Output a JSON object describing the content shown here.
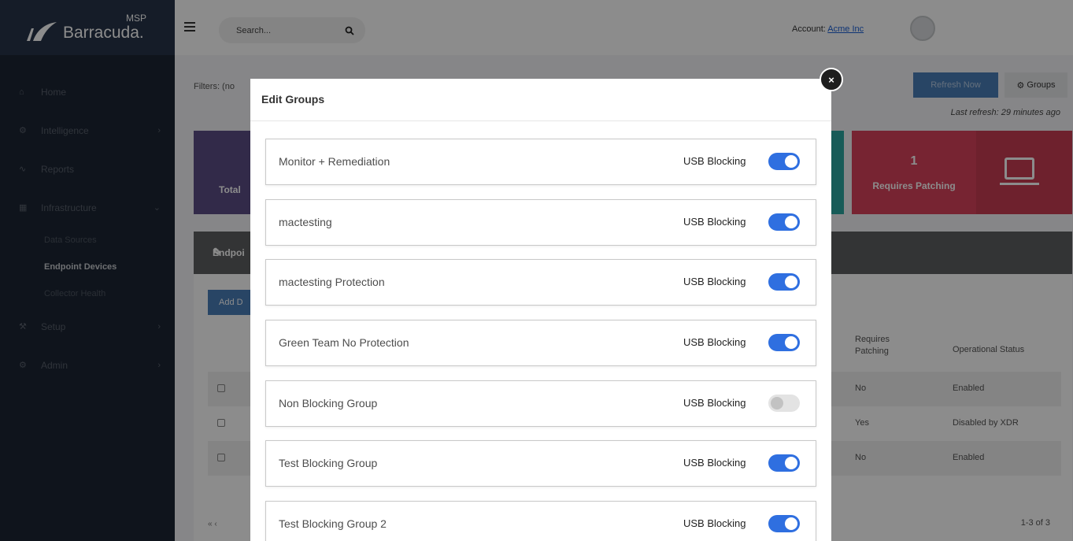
{
  "logo": {
    "msp": "MSP",
    "brand": "Barracuda."
  },
  "topbar": {
    "search_placeholder": "Search...",
    "search_icon": "search-icon",
    "account_label": "Account:",
    "account_name": "Acme Inc"
  },
  "sidebar": {
    "items": [
      {
        "label": "Home",
        "icon": "home-icon"
      },
      {
        "label": "Intelligence",
        "icon": "brain-icon"
      },
      {
        "label": "Reports",
        "icon": "chart-icon"
      },
      {
        "label": "Infrastructure",
        "icon": "building-icon"
      }
    ],
    "subitems": [
      "Data Sources",
      "Endpoint Devices",
      "Collector Health"
    ],
    "items2": [
      {
        "label": "Setup",
        "icon": "wrench-icon"
      },
      {
        "label": "Admin",
        "icon": "gear-icon"
      }
    ]
  },
  "background": {
    "filters_label": "Filters: (no",
    "refresh_button": "Refresh Now",
    "groups_button": "Groups",
    "last_refresh": "Last refresh: 29 minutes ago",
    "total_card_label": "Total",
    "requires_patching_count": "1",
    "requires_patching_label": "Requires Patching",
    "panel_title": "Endpoi",
    "add_button": "Add D",
    "table_headers": {
      "requires_patching": "Requires\nPatching",
      "operational_status": "Operational Status"
    },
    "rows": [
      {
        "patching": "No",
        "status": "Enabled"
      },
      {
        "patching": "Yes",
        "status": "Disabled by XDR"
      },
      {
        "patching": "No",
        "status": "Enabled"
      }
    ],
    "pager": "1-3 of 3"
  },
  "modal": {
    "title": "Edit Groups",
    "close_label": "×",
    "groups": [
      {
        "name": "Monitor + Remediation",
        "usb_label": "USB Blocking",
        "usb_blocking": true
      },
      {
        "name": "mactesting",
        "usb_label": "USB Blocking",
        "usb_blocking": true
      },
      {
        "name": "mactesting Protection",
        "usb_label": "USB Blocking",
        "usb_blocking": true
      },
      {
        "name": "Green Team No Protection",
        "usb_label": "USB Blocking",
        "usb_blocking": true
      },
      {
        "name": "Non Blocking Group",
        "usb_label": "USB Blocking",
        "usb_blocking": false
      },
      {
        "name": "Test Blocking Group",
        "usb_label": "USB Blocking",
        "usb_blocking": true
      },
      {
        "name": "Test Blocking Group 2",
        "usb_label": "USB Blocking",
        "usb_blocking": true
      }
    ]
  },
  "colors": {
    "toggle_on": "#2f6fe0",
    "toggle_off": "#e3e3e3",
    "sidebar_bg": "#1c2533"
  }
}
